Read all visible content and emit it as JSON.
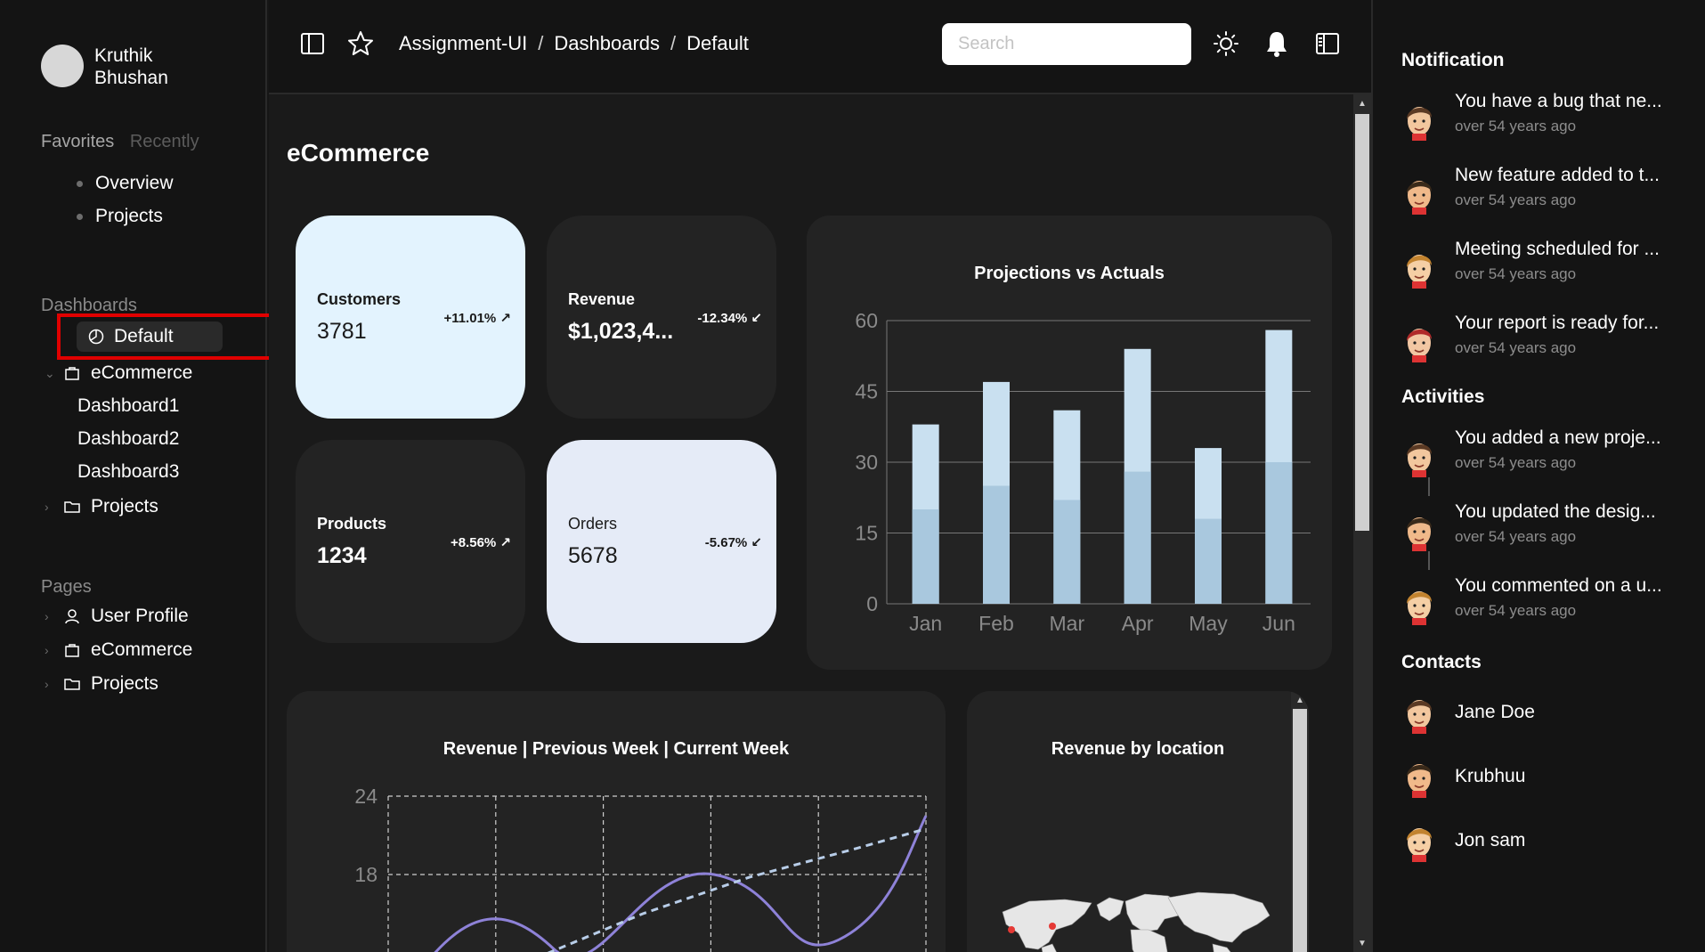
{
  "user": {
    "first_name": "Kruthik",
    "last_name": "Bhushan"
  },
  "sidebar": {
    "tabs": {
      "favorites": "Favorites",
      "recently": "Recently"
    },
    "favorites": [
      "Overview",
      "Projects"
    ],
    "dashboards_title": "Dashboards",
    "dashboards": {
      "default": "Default",
      "ecommerce": "eCommerce",
      "sub": [
        "Dashboard1",
        "Dashboard2",
        "Dashboard3"
      ],
      "projects": "Projects"
    },
    "pages_title": "Pages",
    "pages": [
      "User Profile",
      "eCommerce",
      "Projects"
    ]
  },
  "topbar": {
    "breadcrumb": [
      "Assignment-UI",
      "Dashboards",
      "Default"
    ],
    "search_placeholder": "Search"
  },
  "main": {
    "title": "eCommerce",
    "cards": [
      {
        "label": "Customers",
        "value": "3781",
        "change": "+11.01%",
        "trend": "up"
      },
      {
        "label": "Revenue",
        "value": "$1,023,4...",
        "change": "-12.34%",
        "trend": "down"
      },
      {
        "label": "Products",
        "value": "1234",
        "change": "+8.56%",
        "trend": "up"
      },
      {
        "label": "Orders",
        "value": "5678",
        "change": "-5.67%",
        "trend": "down"
      }
    ],
    "projections_title": "Projections vs Actuals",
    "revenue_title": "Revenue | Previous Week | Current Week",
    "location_title": "Revenue by location"
  },
  "chart_data": [
    {
      "type": "bar",
      "title": "Projections vs Actuals",
      "categories": [
        "Jan",
        "Feb",
        "Mar",
        "Apr",
        "May",
        "Jun"
      ],
      "series": [
        {
          "values": [
            20,
            25,
            22,
            28,
            18,
            30
          ]
        },
        {
          "values": [
            38,
            47,
            41,
            54,
            33,
            58
          ]
        }
      ],
      "ylim": [
        0,
        60
      ],
      "yticks": [
        "0",
        "15",
        "30",
        "45",
        "60"
      ],
      "colors": [
        "#a9c8de",
        "#c9e0f0"
      ],
      "grid": true
    },
    {
      "type": "line",
      "title": "Revenue | Previous Week | Current Week",
      "yticks": [
        "18",
        "24"
      ],
      "ylim": [
        12,
        24
      ],
      "colors": [
        "#8e82d8",
        "#b8cde8"
      ],
      "grid": true
    }
  ],
  "notifications_title": "Notification",
  "notifications": [
    {
      "text": "You have a bug that ne...",
      "time": "over 54 years ago"
    },
    {
      "text": "New feature added to t...",
      "time": "over 54 years ago"
    },
    {
      "text": "Meeting scheduled for ...",
      "time": "over 54 years ago"
    },
    {
      "text": "Your report is ready for...",
      "time": "over 54 years ago"
    }
  ],
  "activities_title": "Activities",
  "activities": [
    {
      "text": "You added a new proje...",
      "time": "over 54 years ago"
    },
    {
      "text": "You updated the desig...",
      "time": "over 54 years ago"
    },
    {
      "text": "You commented on a u...",
      "time": "over 54 years ago"
    }
  ],
  "contacts_title": "Contacts",
  "contacts": [
    "Jane Doe",
    "Krubhuu",
    "Jon sam"
  ]
}
